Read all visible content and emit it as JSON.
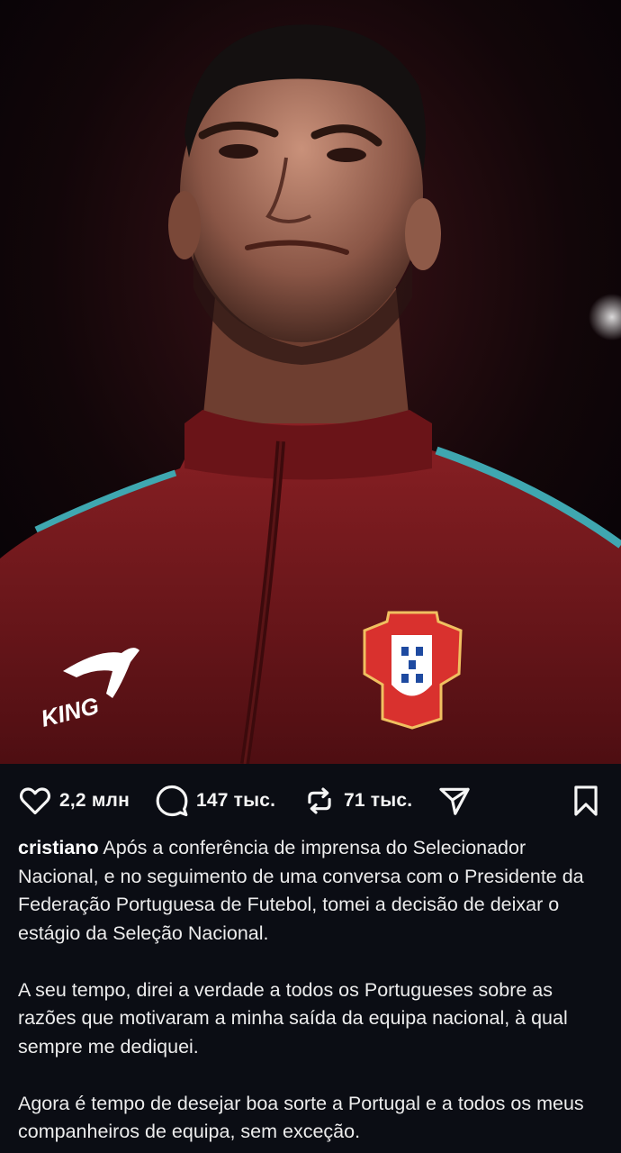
{
  "post": {
    "image_alt": "Photo of a player in a dark red national team jacket",
    "jacket_brand_text": "KING"
  },
  "actions": {
    "likes": "2,2 млн",
    "comments": "147 тыс.",
    "reposts": "71 тыс."
  },
  "caption": {
    "username": "cristiano",
    "paragraph1": "Após a conferência de imprensa do Selecionador Nacional, e no seguimento de uma conversa com o Presidente da Federação Portuguesa de Futebol, tomei a decisão de deixar o estágio da Seleção Nacional.",
    "paragraph2": "A seu tempo, direi a verdade a todos os Portugueses sobre as razões que motivaram a minha saída da equipa nacional, à qual sempre me dediquei.",
    "paragraph3": "Agora é tempo de desejar boa sorte a Portugal e a todos os meus companheiros de equipa, sem exceção."
  },
  "colors": {
    "background": "#0b0d14",
    "jacket": "#7a1a1c",
    "trim": "#3fa7b0",
    "text": "#ececec"
  }
}
